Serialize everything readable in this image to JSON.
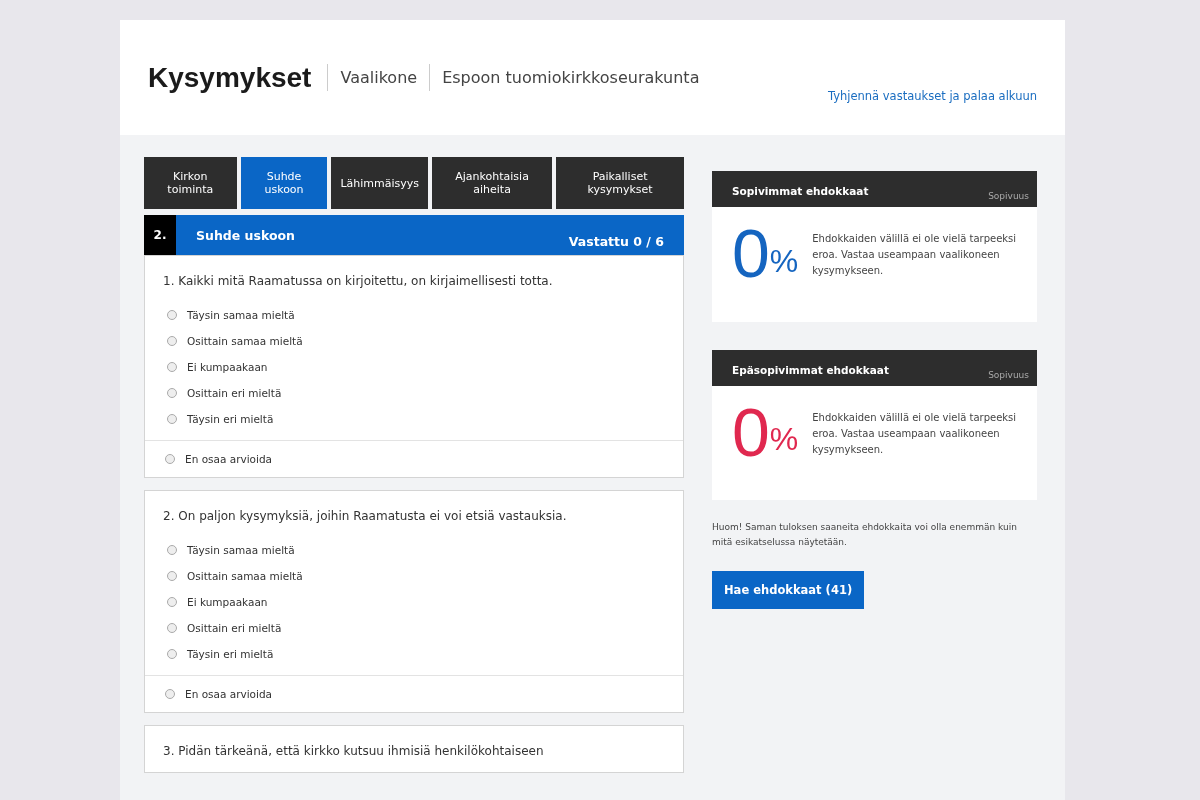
{
  "header": {
    "title": "Kysymykset",
    "crumbs": [
      "Vaalikone",
      "Espoon tuomiokirkkoseurakunta"
    ],
    "reset_link": "Tyhjennä vastaukset ja palaa alkuun"
  },
  "tabs": [
    {
      "label": "Kirkon toiminta",
      "selected": false
    },
    {
      "label": "Suhde uskoon",
      "selected": true
    },
    {
      "label": "Lähimmäisyys",
      "selected": false
    },
    {
      "label": "Ajankohtaisia aiheita",
      "selected": false
    },
    {
      "label": "Paikalliset kysymykset",
      "selected": false
    }
  ],
  "section": {
    "number": "2.",
    "title": "Suhde uskoon",
    "progress": "Vastattu 0 / 6"
  },
  "questions": [
    {
      "text": "1. Kaikki mitä Raamatussa on kirjoitettu, on kirjaimellisesti totta.",
      "options": [
        {
          "label": "Täysin samaa mieltä",
          "selected": false
        },
        {
          "label": "Osittain samaa mieltä",
          "selected": false
        },
        {
          "label": "Ei kumpaakaan",
          "selected": false
        },
        {
          "label": "Osittain eri mieltä",
          "selected": false
        },
        {
          "label": "Täysin eri mieltä",
          "selected": false
        }
      ],
      "skip": {
        "label": "En osaa arvioida",
        "selected": false
      }
    },
    {
      "text": "2. On paljon kysymyksiä, joihin Raamatusta ei voi etsiä vastauksia.",
      "options": [
        {
          "label": "Täysin samaa mieltä",
          "selected": false
        },
        {
          "label": "Osittain samaa mieltä",
          "selected": false
        },
        {
          "label": "Ei kumpaakaan",
          "selected": false
        },
        {
          "label": "Osittain eri mieltä",
          "selected": false
        },
        {
          "label": "Täysin eri mieltä",
          "selected": false
        }
      ],
      "skip": {
        "label": "En osaa arvioida",
        "selected": false
      }
    },
    {
      "text": "3. Pidän tärkeänä, että kirkko kutsuu ihmisiä henkilökohtaiseen"
    }
  ],
  "matches": [
    {
      "title": "Sopivimmat ehdokkaat",
      "column": "Sopivuus",
      "value": "0",
      "unit": "%",
      "color": "#1565c0",
      "message": "Ehdokkaiden välillä ei ole vielä tarpeeksi eroa. Vastaa useampaan vaalikoneen kysymykseen."
    },
    {
      "title": "Epäsopivimmat ehdokkaat",
      "column": "Sopivuus",
      "value": "0",
      "unit": "%",
      "color": "#e0284f",
      "message": "Ehdokkaiden välillä ei ole vielä tarpeeksi eroa. Vastaa useampaan vaalikoneen kysymykseen."
    }
  ],
  "note": "Huom! Saman tuloksen saaneita ehdokkaita voi olla enemmän kuin mitä esikatselussa näytetään.",
  "search_button": "Hae ehdokkaat (41)"
}
